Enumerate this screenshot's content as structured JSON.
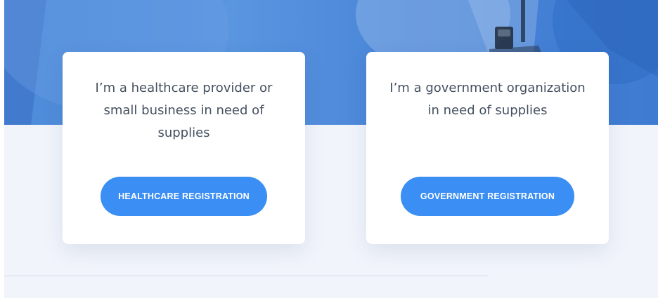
{
  "hero": {
    "image_description_icon": "medical-staff-photo-icon"
  },
  "cards": [
    {
      "text": "I’m a healthcare provider or small business in need of supplies",
      "button_label": "HEALTHCARE REGISTRATION"
    },
    {
      "text": "I’m a government organization in need of supplies",
      "button_label": "GOVERNMENT REGISTRATION"
    }
  ],
  "colors": {
    "accent": "#3b8ef3",
    "hero_blue": "#4d8ad9",
    "background": "#f1f4fb",
    "card": "#ffffff",
    "text": "#44505f"
  }
}
